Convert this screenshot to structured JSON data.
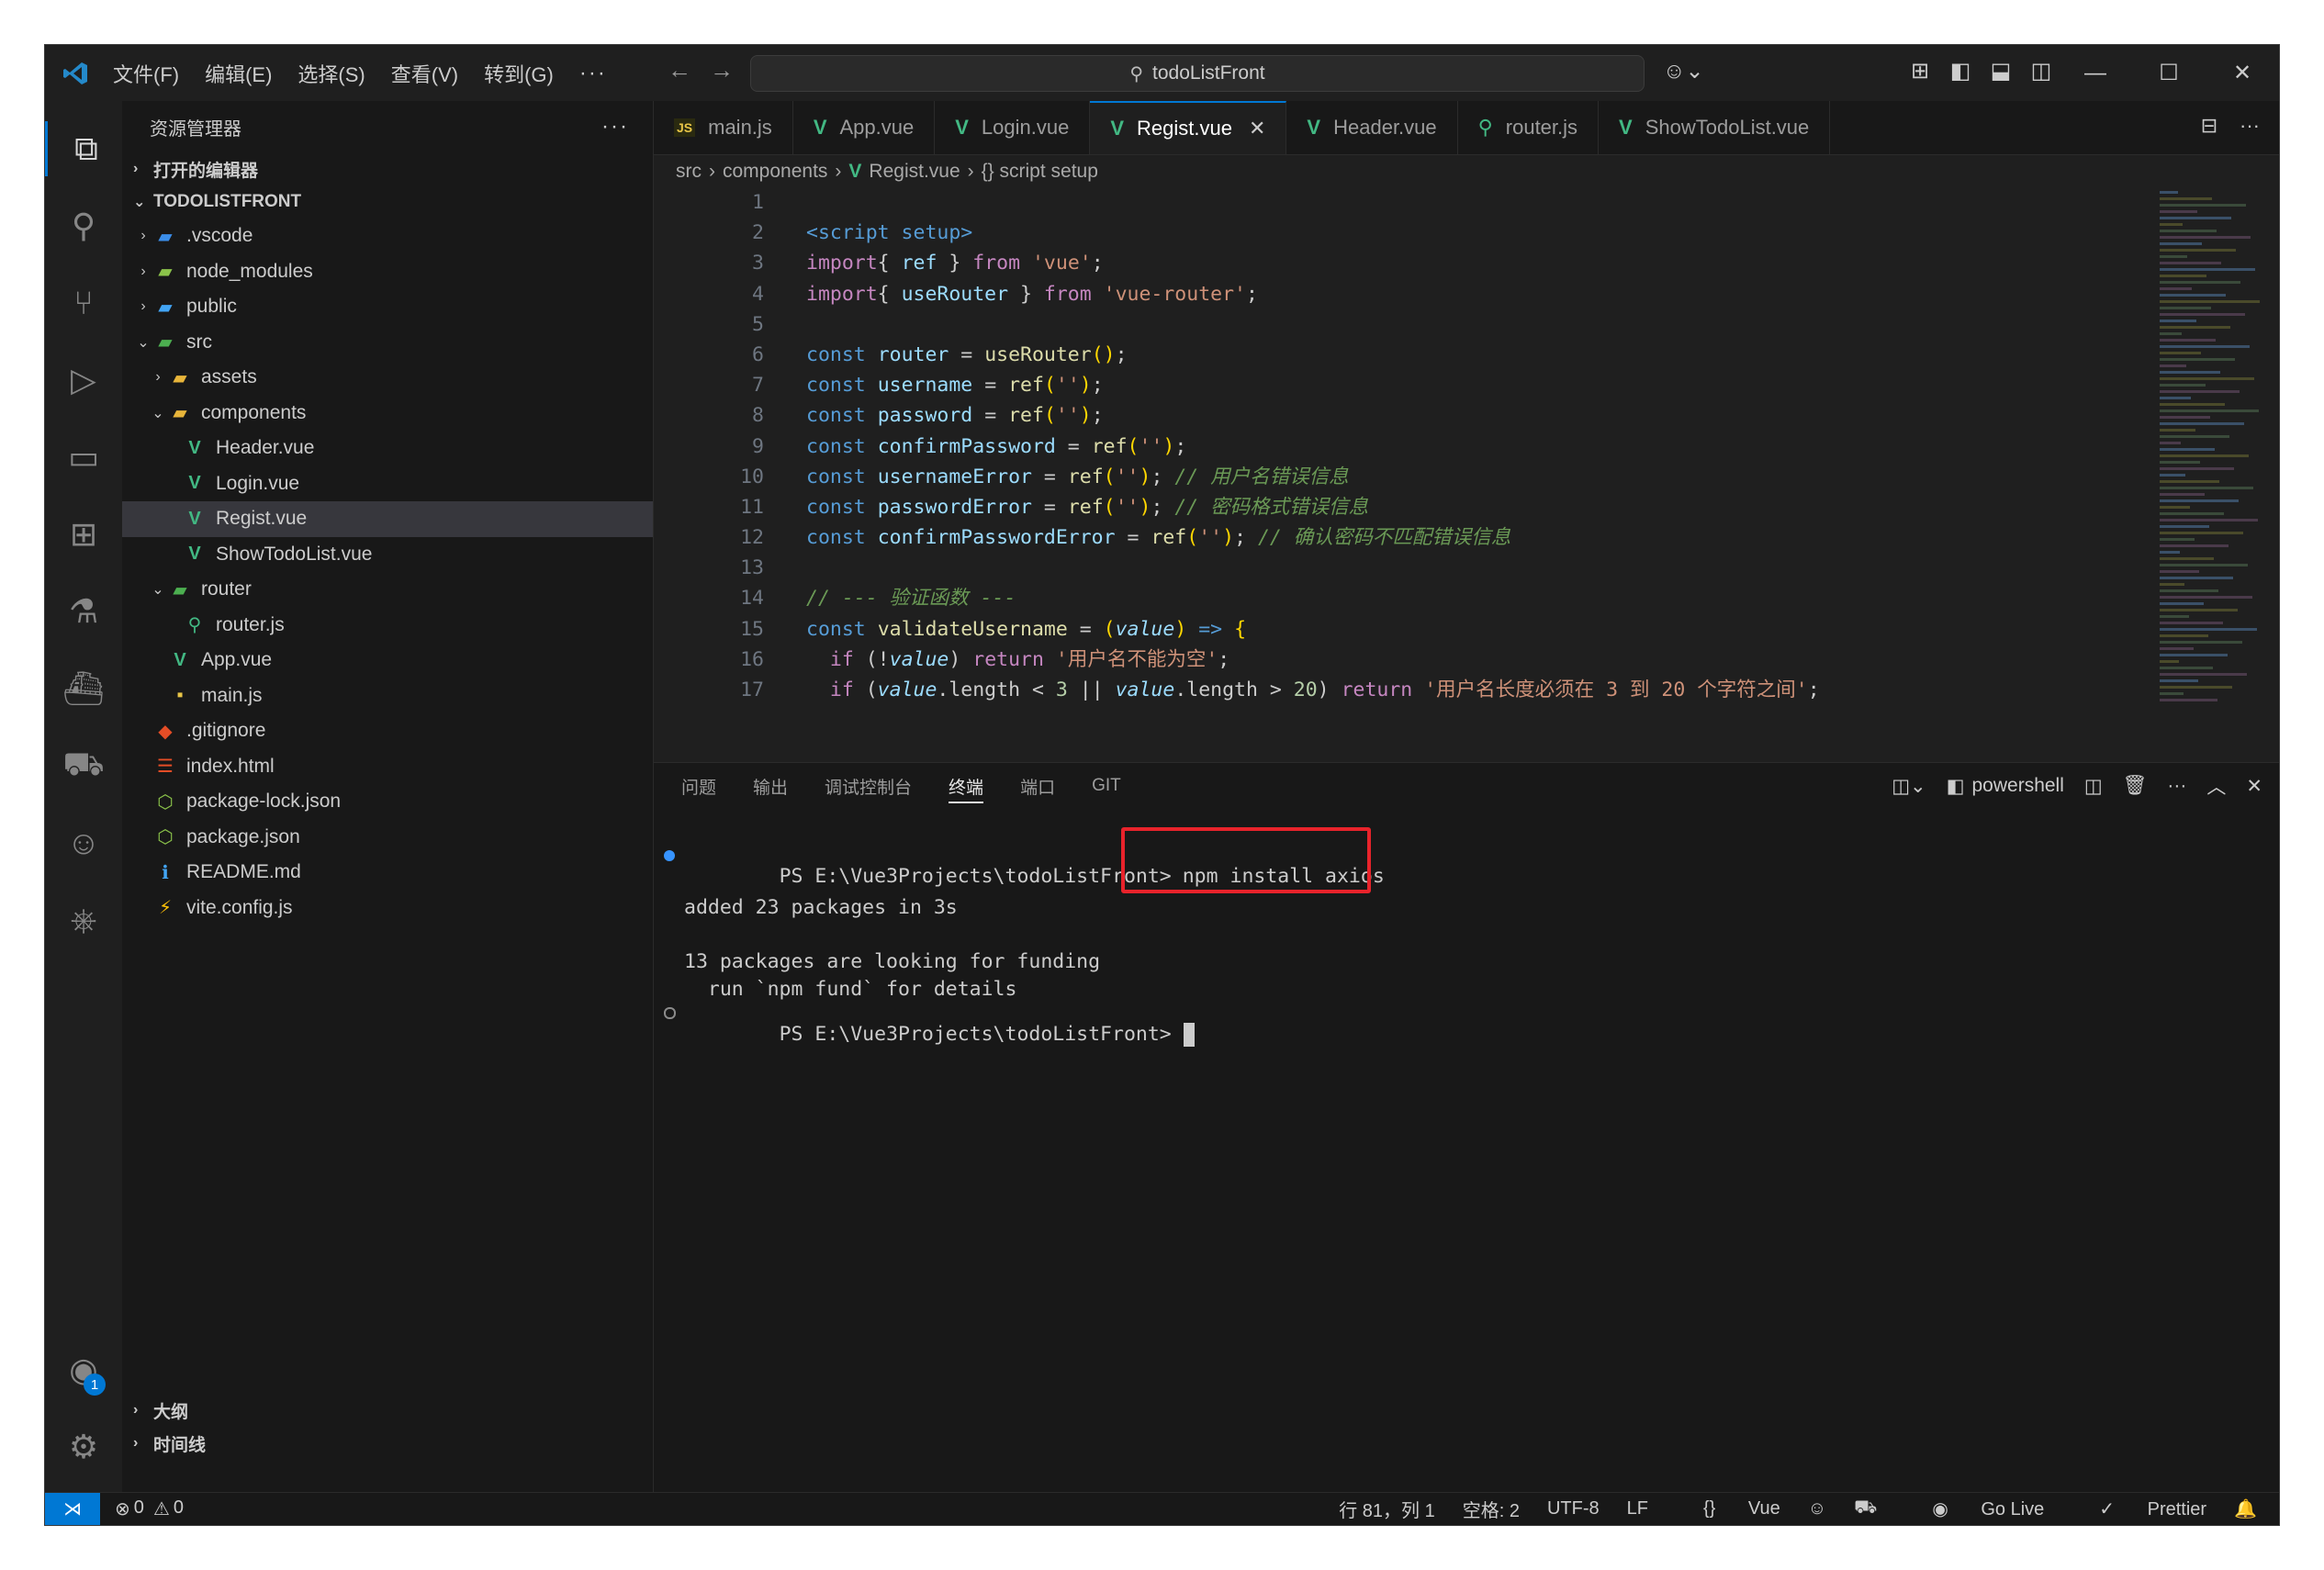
{
  "menu": {
    "items": [
      "文件(F)",
      "编辑(E)",
      "选择(S)",
      "查看(V)",
      "转到(G)"
    ],
    "more": "···"
  },
  "command_center": {
    "text": "todoListFront"
  },
  "sidebar": {
    "title": "资源管理器",
    "open_editors": "打开的编辑器",
    "workspace": "TODOLISTFRONT",
    "tree": [
      {
        "label": ".vscode",
        "depth": 1,
        "chev": "›",
        "icon": "vscode-folder-icon"
      },
      {
        "label": "node_modules",
        "depth": 1,
        "chev": "›",
        "icon": "node-folder-icon"
      },
      {
        "label": "public",
        "depth": 1,
        "chev": "›",
        "icon": "public-folder-icon"
      },
      {
        "label": "src",
        "depth": 1,
        "chev": "⌄",
        "icon": "src-folder-icon"
      },
      {
        "label": "assets",
        "depth": 2,
        "chev": "›",
        "icon": "folder-icon"
      },
      {
        "label": "components",
        "depth": 2,
        "chev": "⌄",
        "icon": "folder-open-icon"
      },
      {
        "label": "Header.vue",
        "depth": 3,
        "chev": "",
        "icon": "vue-file-icon"
      },
      {
        "label": "Login.vue",
        "depth": 3,
        "chev": "",
        "icon": "vue-file-icon"
      },
      {
        "label": "Regist.vue",
        "depth": 3,
        "chev": "",
        "icon": "vue-file-icon",
        "selected": true
      },
      {
        "label": "ShowTodoList.vue",
        "depth": 3,
        "chev": "",
        "icon": "vue-file-icon"
      },
      {
        "label": "router",
        "depth": 2,
        "chev": "⌄",
        "icon": "router-folder-icon"
      },
      {
        "label": "router.js",
        "depth": 3,
        "chev": "",
        "icon": "router-file-icon"
      },
      {
        "label": "App.vue",
        "depth": 2,
        "chev": "",
        "icon": "vue-file-icon"
      },
      {
        "label": "main.js",
        "depth": 2,
        "chev": "",
        "icon": "js-file-icon"
      },
      {
        "label": ".gitignore",
        "depth": 1,
        "chev": "",
        "icon": "git-file-icon"
      },
      {
        "label": "index.html",
        "depth": 1,
        "chev": "",
        "icon": "html-file-icon"
      },
      {
        "label": "package-lock.json",
        "depth": 1,
        "chev": "",
        "icon": "node-file-icon"
      },
      {
        "label": "package.json",
        "depth": 1,
        "chev": "",
        "icon": "node-file-icon"
      },
      {
        "label": "README.md",
        "depth": 1,
        "chev": "",
        "icon": "info-file-icon"
      },
      {
        "label": "vite.config.js",
        "depth": 1,
        "chev": "",
        "icon": "vite-file-icon"
      }
    ],
    "outline": "大纲",
    "timeline": "时间线"
  },
  "tabs": [
    {
      "label": "main.js",
      "icon_text": "JS",
      "icon_color": "#e8c547",
      "active": false
    },
    {
      "label": "App.vue",
      "icon_text": "V",
      "icon_color": "#42b883",
      "active": false
    },
    {
      "label": "Login.vue",
      "icon_text": "V",
      "icon_color": "#42b883",
      "active": false
    },
    {
      "label": "Regist.vue",
      "icon_text": "V",
      "icon_color": "#42b883",
      "active": true
    },
    {
      "label": "Header.vue",
      "icon_text": "V",
      "icon_color": "#42b883",
      "active": false
    },
    {
      "label": "router.js",
      "icon_text": "⚲",
      "icon_color": "#42b883",
      "active": false
    },
    {
      "label": "ShowTodoList.vue",
      "icon_text": "V",
      "icon_color": "#42b883",
      "active": false
    }
  ],
  "breadcrumb": {
    "src": "src",
    "components": "components",
    "file": "Regist.vue",
    "symbol": "{} script setup"
  },
  "code_lines": [
    {
      "n": "1",
      "tokens": []
    },
    {
      "n": "2",
      "tokens": [
        [
          "tag",
          "<script setup>"
        ]
      ]
    },
    {
      "n": "3",
      "tokens": [
        [
          "kw",
          "import"
        ],
        [
          "",
          "{ "
        ],
        [
          "var",
          "ref"
        ],
        [
          "",
          " } "
        ],
        [
          "kw",
          "from"
        ],
        [
          "",
          " "
        ],
        [
          "str",
          "'vue'"
        ],
        [
          "",
          ";"
        ]
      ]
    },
    {
      "n": "4",
      "tokens": [
        [
          "kw",
          "import"
        ],
        [
          "",
          "{ "
        ],
        [
          "var",
          "useRouter"
        ],
        [
          "",
          " } "
        ],
        [
          "kw",
          "from"
        ],
        [
          "",
          " "
        ],
        [
          "str",
          "'vue-router'"
        ],
        [
          "",
          ";"
        ]
      ]
    },
    {
      "n": "5",
      "tokens": []
    },
    {
      "n": "6",
      "tokens": [
        [
          "kw2",
          "const"
        ],
        [
          "",
          " "
        ],
        [
          "var",
          "router"
        ],
        [
          "",
          " = "
        ],
        [
          "fn",
          "useRouter"
        ],
        [
          "par",
          "()"
        ],
        [
          "",
          ";"
        ]
      ]
    },
    {
      "n": "7",
      "tokens": [
        [
          "kw2",
          "const"
        ],
        [
          "",
          " "
        ],
        [
          "var",
          "username"
        ],
        [
          "",
          " = "
        ],
        [
          "fn",
          "ref"
        ],
        [
          "par",
          "("
        ],
        [
          "str",
          "''"
        ],
        [
          "par",
          ")"
        ],
        [
          "",
          ";"
        ]
      ]
    },
    {
      "n": "8",
      "tokens": [
        [
          "kw2",
          "const"
        ],
        [
          "",
          " "
        ],
        [
          "var",
          "password"
        ],
        [
          "",
          " = "
        ],
        [
          "fn",
          "ref"
        ],
        [
          "par",
          "("
        ],
        [
          "str",
          "''"
        ],
        [
          "par",
          ")"
        ],
        [
          "",
          ";"
        ]
      ]
    },
    {
      "n": "9",
      "tokens": [
        [
          "kw2",
          "const"
        ],
        [
          "",
          " "
        ],
        [
          "var",
          "confirmPassword"
        ],
        [
          "",
          " = "
        ],
        [
          "fn",
          "ref"
        ],
        [
          "par",
          "("
        ],
        [
          "str",
          "''"
        ],
        [
          "par",
          ")"
        ],
        [
          "",
          ";"
        ]
      ]
    },
    {
      "n": "10",
      "tokens": [
        [
          "kw2",
          "const"
        ],
        [
          "",
          " "
        ],
        [
          "var",
          "usernameError"
        ],
        [
          "",
          " = "
        ],
        [
          "fn",
          "ref"
        ],
        [
          "par",
          "("
        ],
        [
          "str",
          "''"
        ],
        [
          "par",
          ")"
        ],
        [
          "",
          "; "
        ],
        [
          "cmt",
          "// 用户名错误信息"
        ]
      ]
    },
    {
      "n": "11",
      "tokens": [
        [
          "kw2",
          "const"
        ],
        [
          "",
          " "
        ],
        [
          "var",
          "passwordError"
        ],
        [
          "",
          " = "
        ],
        [
          "fn",
          "ref"
        ],
        [
          "par",
          "("
        ],
        [
          "str",
          "''"
        ],
        [
          "par",
          ")"
        ],
        [
          "",
          "; "
        ],
        [
          "cmt",
          "// 密码格式错误信息"
        ]
      ]
    },
    {
      "n": "12",
      "tokens": [
        [
          "kw2",
          "const"
        ],
        [
          "",
          " "
        ],
        [
          "var",
          "confirmPasswordError"
        ],
        [
          "",
          " = "
        ],
        [
          "fn",
          "ref"
        ],
        [
          "par",
          "("
        ],
        [
          "str",
          "''"
        ],
        [
          "par",
          ")"
        ],
        [
          "",
          "; "
        ],
        [
          "cmt",
          "// 确认密码不匹配错误信息"
        ]
      ]
    },
    {
      "n": "13",
      "tokens": []
    },
    {
      "n": "14",
      "tokens": [
        [
          "cmt",
          "// --- 验证函数 ---"
        ]
      ]
    },
    {
      "n": "15",
      "tokens": [
        [
          "kw2",
          "const"
        ],
        [
          "",
          " "
        ],
        [
          "fn",
          "validateUsername"
        ],
        [
          "",
          " = "
        ],
        [
          "par",
          "("
        ],
        [
          "it",
          "value"
        ],
        [
          "par",
          ")"
        ],
        [
          "",
          " "
        ],
        [
          "kw2",
          "=>"
        ],
        [
          "",
          " "
        ],
        [
          "par",
          "{"
        ]
      ]
    },
    {
      "n": "16",
      "tokens": [
        [
          "",
          "  "
        ],
        [
          "kw",
          "if"
        ],
        [
          "",
          " ("
        ],
        [
          "",
          "!"
        ],
        [
          "it",
          "value"
        ],
        [
          "",
          ") "
        ],
        [
          "kw",
          "return"
        ],
        [
          "",
          " "
        ],
        [
          "str",
          "'用户名不能为空'"
        ],
        [
          "",
          ";"
        ]
      ]
    },
    {
      "n": "17",
      "tokens": [
        [
          "",
          "  "
        ],
        [
          "kw",
          "if"
        ],
        [
          "",
          " ("
        ],
        [
          "it",
          "value"
        ],
        [
          "",
          ".length "
        ],
        [
          "",
          "< "
        ],
        [
          "num",
          "3"
        ],
        [
          "",
          " || "
        ],
        [
          "it",
          "value"
        ],
        [
          "",
          ".length "
        ],
        [
          "",
          "> "
        ],
        [
          "num",
          "20"
        ],
        [
          "",
          ") "
        ],
        [
          "kw",
          "return"
        ],
        [
          "",
          " "
        ],
        [
          "str",
          "'用户名长度必须在 3 到 20 个字符之间'"
        ],
        [
          "",
          ";"
        ]
      ]
    }
  ],
  "panel": {
    "tabs": [
      "问题",
      "输出",
      "调试控制台",
      "终端",
      "端口",
      "GIT"
    ],
    "active_tab": "终端",
    "shell": "powershell",
    "terminal": {
      "prompt1": "PS E:\\Vue3Projects\\todoListFront>",
      "command": "npm install axios",
      "out1": "added 23 packages in 3s",
      "out2": "13 packages are looking for funding",
      "out3": "  run `npm fund` for details",
      "prompt2": "PS E:\\Vue3Projects\\todoListFront>"
    }
  },
  "statusbar": {
    "errors": "0",
    "warnings": "0",
    "position": "行 81，列 1",
    "spaces": "空格: 2",
    "encoding": "UTF-8",
    "eol": "LF",
    "language": "Vue",
    "golive": "Go Live",
    "prettier": "Prettier"
  },
  "activity": {
    "accounts_badge": "1"
  },
  "colors": {
    "accent": "#0078d4",
    "highlight": "#e8232b",
    "vue": "#42b883"
  }
}
